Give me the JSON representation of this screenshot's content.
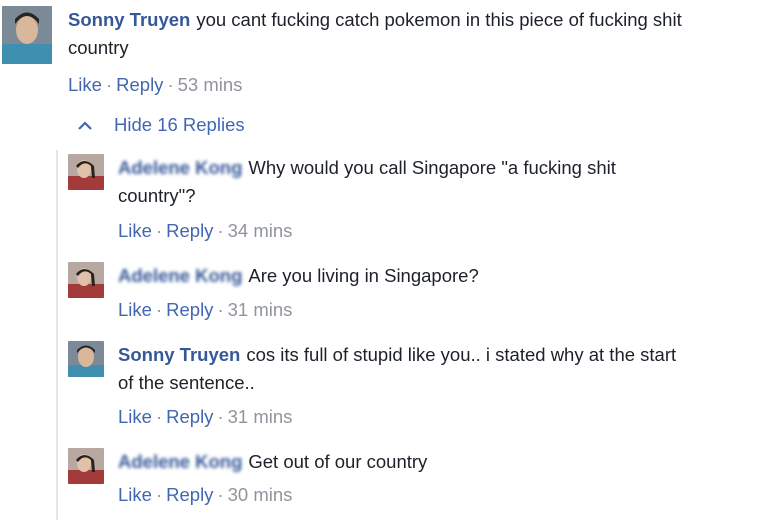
{
  "comment": {
    "author": "Sonny Truyen",
    "text_line1": "you cant fucking catch pokemon in this piece of fucking shit",
    "text_line2": "country",
    "like": "Like",
    "reply": "Reply",
    "time": "53 mins"
  },
  "hide_replies": {
    "icon": "chevron-up-icon",
    "label": "Hide 16 Replies"
  },
  "replies": [
    {
      "author": "Adelene Kong",
      "text_line1": "Why would you call Singapore \"a fucking shit",
      "text_line2": "country\"?",
      "like": "Like",
      "reply": "Reply",
      "time": "34 mins"
    },
    {
      "author": "Adelene Kong",
      "text": "Are you living in Singapore?",
      "like": "Like",
      "reply": "Reply",
      "time": "31 mins"
    },
    {
      "author": "Sonny Truyen",
      "text_line1": "cos its full of stupid like you.. i stated why at the start",
      "text_line2": "of the sentence..",
      "like": "Like",
      "reply": "Reply",
      "time": "31 mins"
    },
    {
      "author": "Adelene Kong",
      "text": "Get out of our country",
      "like": "Like",
      "reply": "Reply",
      "time": "30 mins"
    }
  ]
}
